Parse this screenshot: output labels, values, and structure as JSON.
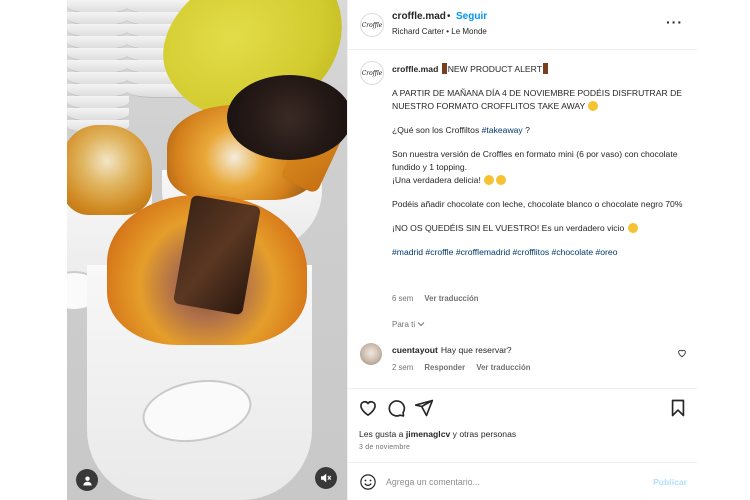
{
  "post": {
    "username": "croffle.mad",
    "follow_label": "Seguir",
    "subtitle": "Richard Carter • Le Monde",
    "more_icon": "more-horizontal-icon",
    "avatar_text": "Croffle"
  },
  "caption": {
    "username": "croffle.mad",
    "line1": "NEW PRODUCT ALERT",
    "announcement": "A PARTIR DE MAÑANA DÍA 4 DE NOVIEMBRE PODÉIS DISFRUTRAR DE NUESTRO FORMATO CROFFLITOS TAKE AWAY",
    "question": "¿Qué son los Croffiltos ",
    "question_tag": "#takeaway",
    "question_end": " ?",
    "description": "Son nuestra versión de Croffles en formato mini (6 por vaso) con chocolate fundido y 1 topping.",
    "delight": "¡Una verdadera delicia! ",
    "options": "Podéis añadir chocolate con leche, chocolate blanco o chocolate negro 70%",
    "cta": "¡NO OS QUEDÉIS SIN EL VUESTRO! Es un verdadero vicio ",
    "hashtags": "#madrid #croffle #crofflemadrid #crofflitos #chocolate #oreo",
    "time": "6 sem",
    "translate": "Ver traducción"
  },
  "para_ti": "Para ti",
  "comment": {
    "username": "cuentayout",
    "text": "Hay que reservar?",
    "time": "2 sem",
    "reply": "Responder",
    "translate": "Ver traducción"
  },
  "likes": {
    "prefix": "Les gusta a ",
    "user": "jimenaglcv",
    "suffix": " y otras personas"
  },
  "date": "3 de noviembre",
  "comment_box": {
    "placeholder": "Agrega un comentario...",
    "publish": "Publicar"
  },
  "icons": {
    "like": "heart-icon",
    "comment": "comment-icon",
    "share": "send-icon",
    "save": "bookmark-icon",
    "emoji": "smiley-icon",
    "user_tag": "user-icon",
    "mute": "muted-speaker-icon"
  },
  "colors": {
    "link": "#0095f6",
    "hashtag": "#00376b",
    "muted_text": "#737373",
    "publish_disabled": "#b2dffc"
  }
}
